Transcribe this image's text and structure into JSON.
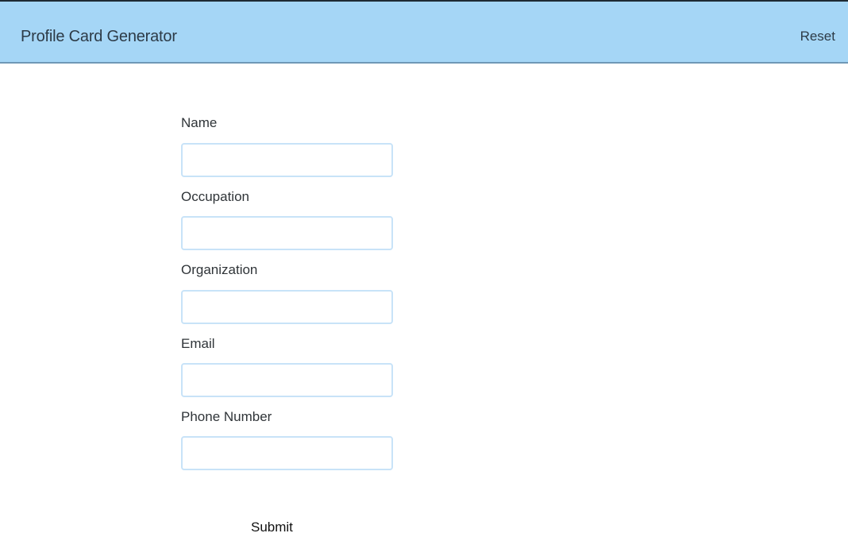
{
  "header": {
    "title": "Profile Card Generator",
    "reset_label": "Reset"
  },
  "form": {
    "fields": [
      {
        "label": "Name",
        "value": "",
        "placeholder": ""
      },
      {
        "label": "Occupation",
        "value": "",
        "placeholder": ""
      },
      {
        "label": "Organization",
        "value": "",
        "placeholder": ""
      },
      {
        "label": "Email",
        "value": "",
        "placeholder": ""
      },
      {
        "label": "Phone Number",
        "value": "",
        "placeholder": ""
      }
    ],
    "submit_label": "Submit"
  },
  "colors": {
    "header_background": "#a5d6f6",
    "input_border": "#c8e3f8"
  }
}
